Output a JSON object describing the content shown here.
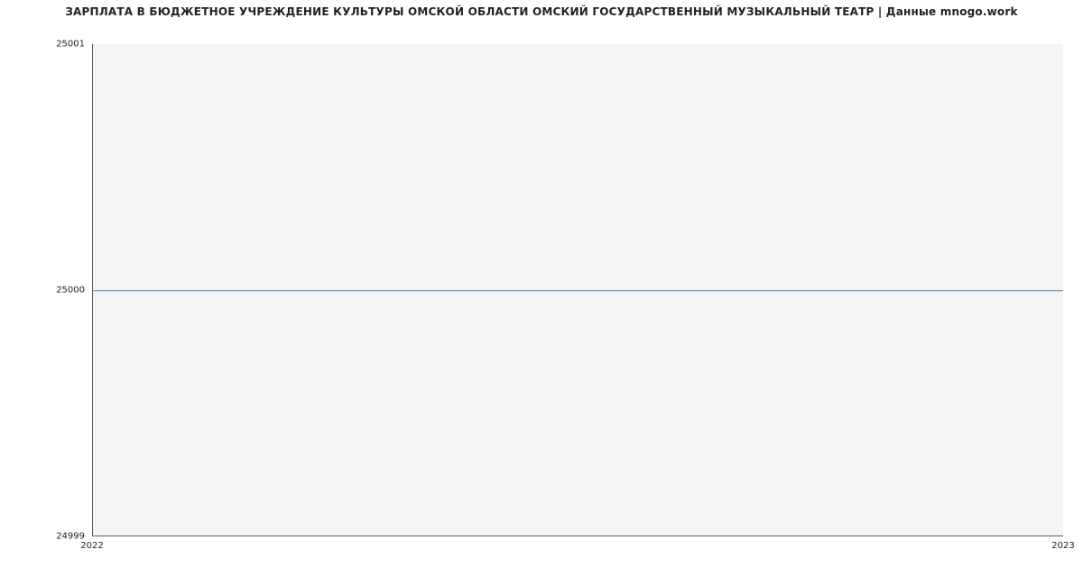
{
  "chart_data": {
    "type": "line",
    "title": "ЗАРПЛАТА В БЮДЖЕТНОЕ УЧРЕЖДЕНИЕ КУЛЬТУРЫ ОМСКОЙ ОБЛАСТИ ОМСКИЙ ГОСУДАРСТВЕННЫЙ МУЗЫКАЛЬНЫЙ ТЕАТР | Данные mnogo.work",
    "xlabel": "",
    "ylabel": "",
    "x": [
      2022,
      2023
    ],
    "values": [
      25000,
      25000
    ],
    "x_ticks": [
      "2022",
      "2023"
    ],
    "y_ticks": [
      "24999",
      "25000",
      "25001"
    ],
    "xlim": [
      2022,
      2023
    ],
    "ylim": [
      24999,
      25001
    ],
    "line_color": "#4a7ebb",
    "plot_bg": "#f4f4f4"
  }
}
